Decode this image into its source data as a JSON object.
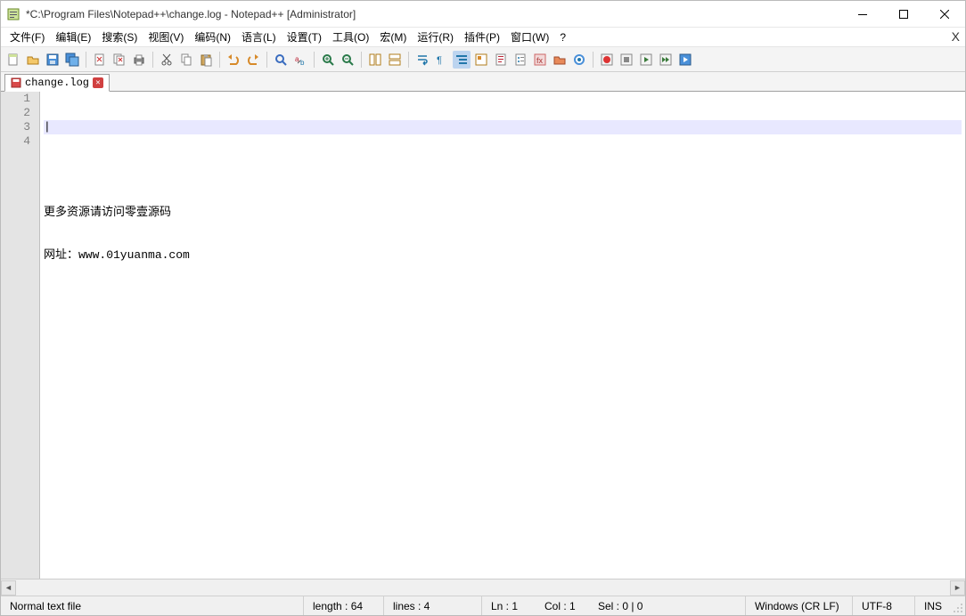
{
  "titlebar": {
    "text": "*C:\\Program Files\\Notepad++\\change.log - Notepad++ [Administrator]"
  },
  "menu": {
    "file": "文件(F)",
    "edit": "编辑(E)",
    "search": "搜索(S)",
    "view": "视图(V)",
    "encoding": "编码(N)",
    "language": "语言(L)",
    "settings": "设置(T)",
    "tools": "工具(O)",
    "macro": "宏(M)",
    "run": "运行(R)",
    "plugins": "插件(P)",
    "window": "窗口(W)",
    "help": "?",
    "close_x": "X"
  },
  "tabs": {
    "current": {
      "label": "change.log"
    }
  },
  "editor": {
    "gutter": [
      "1",
      "2",
      "3",
      "4"
    ],
    "lines": [
      "",
      "",
      "更多资源请访问零壹源码",
      "网址：www.01yuanma.com"
    ]
  },
  "statusbar": {
    "doctype": "Normal text file",
    "length": "length : 64",
    "lines": "lines : 4",
    "ln": "Ln : 1",
    "col": "Col : 1",
    "sel": "Sel : 0 | 0",
    "eol": "Windows (CR LF)",
    "encoding": "UTF-8",
    "ins": "INS"
  },
  "icons": {
    "toolbar_order": [
      "new",
      "open",
      "save",
      "save-all",
      "close",
      "close-all",
      "print",
      "cut",
      "copy",
      "paste",
      "undo",
      "redo",
      "find",
      "replace",
      "zoom-in",
      "zoom-out",
      "sync",
      "wordwrap",
      "allchars",
      "indent",
      "fold",
      "unfold",
      "hide",
      "doc-map",
      "func-list",
      "doc1",
      "monitor",
      "record",
      "stop",
      "play",
      "play-multi",
      "save-macro"
    ]
  }
}
